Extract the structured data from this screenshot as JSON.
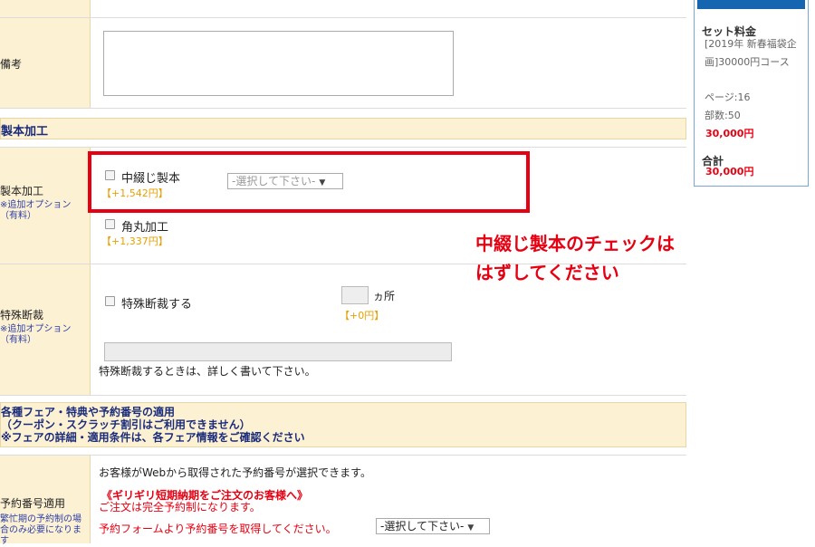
{
  "rows": {
    "remarks_label": "備考",
    "binding_section_title": "製本加工",
    "binding_label": "製本加工",
    "binding_note": "※追加オプション（有料）",
    "saddle_stitch": {
      "label": "中綴じ製本",
      "price": "【+1,542円】"
    },
    "binding_select": "-選択して下さい-",
    "round_corner": {
      "label": "角丸加工",
      "price": "【+1,337円】"
    },
    "special_cut_label": "特殊断裁",
    "special_cut_note": "※追加オプション（有料）",
    "special_cut_checkbox": "特殊断裁する",
    "special_cut_unit": "ヵ所",
    "special_cut_price": "【+0円】",
    "special_cut_hint": "特殊断裁するときは、詳しく書いて下さい。",
    "fair_section": {
      "line1": "各種フェア・特典や予約番号の適用",
      "line2": "（クーポン・スクラッチ割引はご利用できません）",
      "line3": "※フェアの詳細・適用条件は、各フェア情報をご確認ください"
    },
    "reservation_label": "予約番号適用",
    "reservation_note": "繁忙期の予約制の場合のみ必要になります",
    "reservation_info": "お客様がWebから取得された予約番号が選択できます。",
    "rush_title": "《ギリギリ短期納期をご注文のお客様へ》",
    "rush_line": "ご注文は完全予約制になります。",
    "reservation_prompt": "予約フォームより予約番号を取得してください。",
    "reservation_select": "-選択して下さい-"
  },
  "annotation": {
    "line1": "中綴じ製本のチェックは",
    "line2": "はずしてください",
    "color": "#e60012"
  },
  "sidebar": {
    "set_price_label": "セット料金",
    "item_name": "[2019年 新春福袋企画]30000円コース",
    "pages": "ページ:16",
    "copies": "部数:50",
    "set_price": "30,000円",
    "total_label": "合計",
    "total": "30,000円"
  },
  "colors": {
    "label_bg": "#fdf1d3",
    "note_blue": "#2c3fa8",
    "price_orange": "#e8a000",
    "sidebar_header_blue": "#1565b0"
  }
}
